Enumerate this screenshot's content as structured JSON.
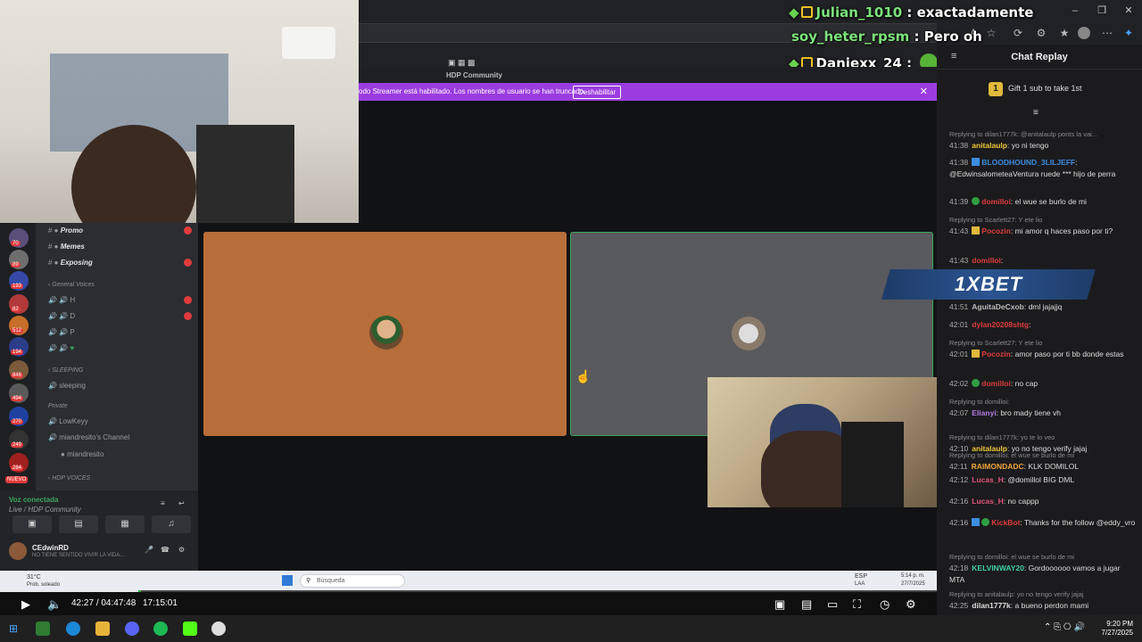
{
  "overlay_chat": [
    {
      "user": "Julian_1010",
      "text": "exactadamente",
      "badges": true
    },
    {
      "user": "soy_heter_rpsm",
      "text": "Pero oh",
      "badges": false
    },
    {
      "user": "Daniexx_24",
      "text": "",
      "badges": true,
      "emote": true
    }
  ],
  "discord": {
    "banner_text": "odo Streamer está habilitado. Los nombres de usuario se han truncado.",
    "banner_button": "Deshabilitar",
    "titlebar": "HDP Community",
    "channels": [
      {
        "name": "Promo",
        "ping": true
      },
      {
        "name": "Memes",
        "ping": false
      },
      {
        "name": "Exposing",
        "ping": true
      }
    ],
    "categories": {
      "general_voices": "General Voices",
      "sleeping": "SLEEPING",
      "private": "Private",
      "hdp_voices": "HDP VOICES"
    },
    "voice_channels": [
      "H",
      "D",
      "P",
      ""
    ],
    "sleeping_channel": "sleeping",
    "private_channels": [
      "LowKeyy",
      "miandresito's Channel"
    ],
    "private_member": "miandresito",
    "voice_status": "Voz conectada",
    "voice_sub": "Live / HDP Community",
    "user_name": "CEdwinRD",
    "user_status": "NO TIENE SENTIDO VIVIR LA VIDA...",
    "server_counts": [
      "70",
      "89",
      "193",
      "82",
      "512",
      "194",
      "846",
      "494",
      "270",
      "249",
      "284"
    ],
    "new_label": "NUEVO"
  },
  "inner_taskbar": {
    "weather": "31°C",
    "weather_sub": "Prob. soleado",
    "search_placeholder": "Búsqueda",
    "lang": "ESP",
    "lang_sub": "LAA",
    "time": "5:14 p. m.",
    "date": "27/7/2025"
  },
  "player": {
    "current": "42:27",
    "separator": "/",
    "duration": "04:47:48",
    "clock": "17:15:01",
    "progress_fraction": 0.148,
    "buffer_fraction": 0.15
  },
  "chat_replay": {
    "title": "Chat Replay",
    "gift_text": "Gift 1 sub to take 1st",
    "gift_rank": "1",
    "bet_label": "1XBET",
    "messages": [
      {
        "reply": "Replying to dilan1777k: @anitalaulp ponts la vai...",
        "time": "41:38",
        "user": "anitalaulp",
        "color": "#f0c93a",
        "text": "yo ni tengo"
      },
      {
        "time": "41:38",
        "user": "BLOODHOUND_3LILJEFF",
        "color": "#3d8de0",
        "badge": "p",
        "text": "@EdwinsalometeaVentura ruede *** hijo de perra"
      },
      {
        "time": "41:39",
        "user": "domilloi",
        "color": "#e03c3c",
        "badge": "v",
        "text": "el wue se burlo de mi"
      },
      {
        "reply": "Replying to Scarlett27: Y ete lio",
        "time": "41:43",
        "user": "Pocozin",
        "color": "#e03c3c",
        "badge": "s",
        "text": "mi amor q haces paso por ti?"
      },
      {
        "time": "41:43",
        "user": "domilloi",
        "color": "#e03c3c",
        "text": ""
      },
      {
        "time": "41:51",
        "user": "AguitaDeCxob",
        "color": "#bbbbbb",
        "text": "dml jajajjq"
      },
      {
        "time": "42:01",
        "user": "dylan20208shtg",
        "color": "#e03c3c",
        "text": ""
      },
      {
        "reply": "Replying to Scarlett27: Y ete lio",
        "time": "42:01",
        "user": "Pocozin",
        "color": "#e03c3c",
        "badge": "s",
        "text": "amor paso por ti bb donde estas"
      },
      {
        "time": "42:02",
        "user": "domilloi",
        "color": "#e03c3c",
        "badge": "v",
        "text": "no cap"
      },
      {
        "reply": "Replying to domilloi:",
        "time": "42:07",
        "user": "Elianyi",
        "color": "#b77be8",
        "text": "bro mady tiene vh"
      },
      {
        "reply": "Replying to dilan1777k: yo te lo veo",
        "time": "42:10",
        "user": "anitalaulp",
        "color": "#f0c93a",
        "text": "yo no tengo verify jajaj"
      },
      {
        "reply": "Replying to domilloi: el wue se burlo de mi",
        "time": "42:11",
        "user": "RAIMONDADC",
        "color": "#f0a53a",
        "text": "KLK DOMILOL"
      },
      {
        "time": "42:12",
        "user": "Lucas_H",
        "color": "#e0557a",
        "text": "@domillol BIG DML"
      },
      {
        "time": "42:16",
        "user": "Lucas_H",
        "color": "#e0557a",
        "text": "no cappp"
      },
      {
        "time": "42:16",
        "user": "KickBot",
        "color": "#e03c3c",
        "badge": "pv",
        "text": "Thanks for the follow @eddy_vro"
      },
      {
        "reply": "Replying to domilloi: el wue se burlo de mi",
        "time": "42:18",
        "user": "KELVINWAY20",
        "color": "#3ecfa0",
        "text": "Gordoooooo vamos a jugar MTA"
      },
      {
        "reply": "Replying to anitalaulp: yo no tengo verify jajaj",
        "time": "42:25",
        "user": "dilan1777k",
        "color": "#dddddd",
        "text": "a bueno perdon mami"
      }
    ]
  },
  "os_taskbar": {
    "time": "9:20 PM",
    "date": "7/27/2025"
  }
}
